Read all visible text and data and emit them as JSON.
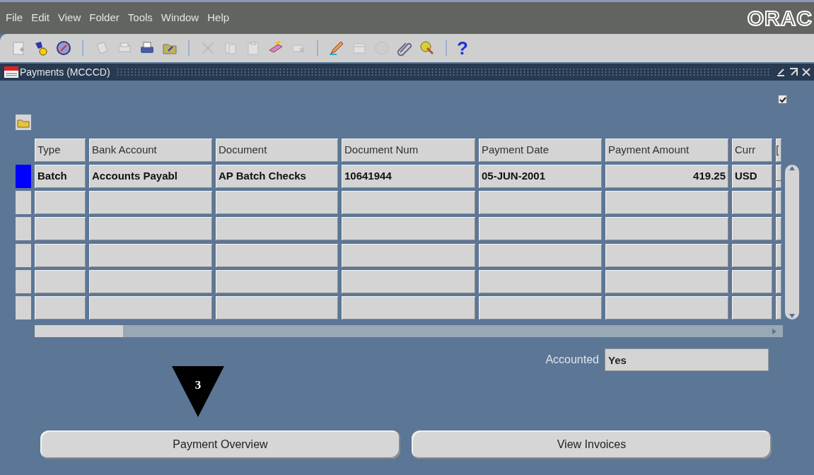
{
  "menu_bar": {
    "items": [
      "File",
      "Edit",
      "View",
      "Folder",
      "Tools",
      "Window",
      "Help"
    ],
    "logo": "ORAC"
  },
  "toolbar": [
    {
      "disabled": true
    },
    {
      "disabled": false
    },
    {
      "disabled": false
    },
    {
      "kind": "separator"
    },
    {
      "disabled": true
    },
    {
      "disabled": true
    },
    {
      "disabled": false
    },
    {
      "disabled": false
    },
    {
      "kind": "separator"
    },
    {
      "disabled": true
    },
    {
      "disabled": true
    },
    {
      "disabled": true
    },
    {
      "disabled": false
    },
    {
      "disabled": true
    },
    {
      "kind": "separator"
    },
    {
      "disabled": false
    },
    {
      "disabled": true
    },
    {
      "disabled": true
    },
    {
      "disabled": false
    },
    {
      "disabled": false
    },
    {
      "kind": "separator"
    },
    {
      "kind": "help",
      "glyph": "?"
    }
  ],
  "window": {
    "title": "Payments (MCCCD)",
    "checked": true
  },
  "table": {
    "columns": [
      "Type",
      "Bank Account",
      "Document",
      "Document Num",
      "Payment Date",
      "Payment Amount",
      "Curr",
      "["
    ],
    "rows": [
      {
        "current": true,
        "cells": [
          "Batch",
          "Accounts Payabl",
          "AP Batch Checks",
          "10641944",
          "05-JUN-2001",
          "419.25",
          "USD",
          "_"
        ]
      },
      {
        "current": false
      },
      {
        "current": false
      },
      {
        "current": false
      },
      {
        "current": false
      },
      {
        "current": false
      }
    ]
  },
  "accounted": {
    "label": "Accounted",
    "value": "Yes"
  },
  "callout": {
    "label": "3"
  },
  "buttons": [
    "Payment Overview",
    "View Invoices"
  ]
}
